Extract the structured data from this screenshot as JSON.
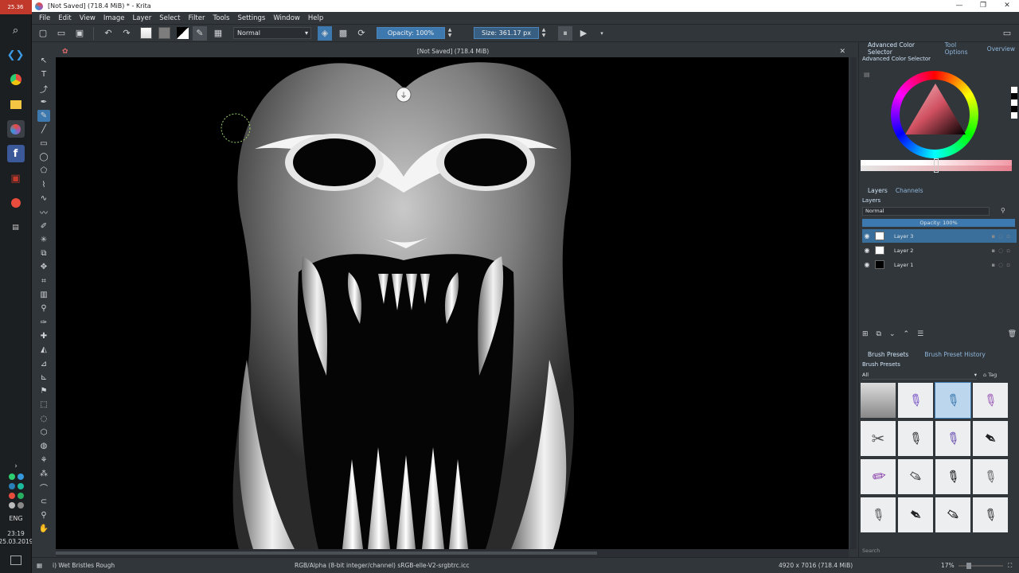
{
  "taskbar": {
    "top_clock": "25.36",
    "language": "ENG",
    "time": "23:19",
    "date": "25.03.2019"
  },
  "window": {
    "title": "[Not Saved]  (718.4 MiB) * - Krita"
  },
  "menu": [
    "File",
    "Edit",
    "View",
    "Image",
    "Layer",
    "Select",
    "Filter",
    "Tools",
    "Settings",
    "Window",
    "Help"
  ],
  "toolbar": {
    "blend_mode": "Normal",
    "opacity_label": "Opacity: 100%",
    "size_label": "Size: 361.17 px"
  },
  "canvas": {
    "header": "[Not Saved]  (718.4 MiB)"
  },
  "dock": {
    "top_tabs": [
      "Advanced Color Selector",
      "Tool Options",
      "Overview"
    ],
    "color_selector_title": "Advanced Color Selector",
    "layers_tabs": [
      "Layers",
      "Channels"
    ],
    "layers_title": "Layers",
    "layer_blend": "Normal",
    "layer_opacity": "Opacity:  100%",
    "layers": [
      {
        "name": "Layer 3",
        "selected": true
      },
      {
        "name": "Layer 2",
        "selected": false
      },
      {
        "name": "Layer 1",
        "selected": false
      }
    ],
    "presets_tabs": [
      "Brush Presets",
      "Brush Preset History"
    ],
    "presets_title": "Brush Presets",
    "preset_filter": "All",
    "preset_tag": "Tag",
    "preset_search": "Search"
  },
  "status": {
    "brush": "i) Wet Bristles Rough",
    "color_space": "RGB/Alpha (8-bit integer/channel)  sRGB-elle-V2-srgbtrc.icc",
    "dimensions": "4920 x 7016 (718.4 MiB)",
    "zoom": "17%"
  },
  "colors": {
    "accent": "#3d79ae",
    "panel": "#31363b",
    "canvas": "#000000"
  }
}
